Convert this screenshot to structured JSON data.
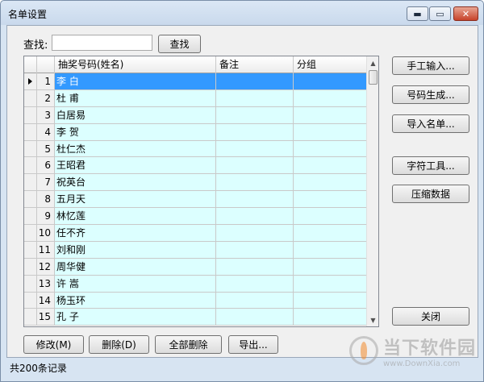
{
  "window": {
    "title": "名单设置"
  },
  "titlebar_buttons": {
    "minimize": "▬",
    "maximize": "▭",
    "close": "✕"
  },
  "search": {
    "label": "查找:",
    "value": "",
    "placeholder": "",
    "button": "查找"
  },
  "table": {
    "columns": [
      "抽奖号码(姓名)",
      "备注",
      "分组"
    ],
    "rows": [
      {
        "num": "1",
        "name": "李  白",
        "note": "",
        "group": "",
        "selected": true
      },
      {
        "num": "2",
        "name": "杜  甫",
        "note": "",
        "group": ""
      },
      {
        "num": "3",
        "name": "白居易",
        "note": "",
        "group": ""
      },
      {
        "num": "4",
        "name": "李  贺",
        "note": "",
        "group": ""
      },
      {
        "num": "5",
        "name": "杜仁杰",
        "note": "",
        "group": ""
      },
      {
        "num": "6",
        "name": "王昭君",
        "note": "",
        "group": ""
      },
      {
        "num": "7",
        "name": "祝英台",
        "note": "",
        "group": ""
      },
      {
        "num": "8",
        "name": "五月天",
        "note": "",
        "group": ""
      },
      {
        "num": "9",
        "name": "林忆莲",
        "note": "",
        "group": ""
      },
      {
        "num": "10",
        "name": "任不齐",
        "note": "",
        "group": ""
      },
      {
        "num": "11",
        "name": "刘和刚",
        "note": "",
        "group": ""
      },
      {
        "num": "12",
        "name": "周华健",
        "note": "",
        "group": ""
      },
      {
        "num": "13",
        "name": "许  嵩",
        "note": "",
        "group": ""
      },
      {
        "num": "14",
        "name": "杨玉环",
        "note": "",
        "group": ""
      },
      {
        "num": "15",
        "name": "孔  子",
        "note": "",
        "group": ""
      }
    ]
  },
  "side_buttons": {
    "manual_input": "手工输入...",
    "generate_numbers": "号码生成...",
    "import_list": "导入名单...",
    "char_tools": "字符工具...",
    "compress_data": "压缩数据",
    "close": "关闭"
  },
  "bottom_buttons": {
    "edit": "修改(M)",
    "delete": "删除(D)",
    "delete_all": "全部删除",
    "export": "导出..."
  },
  "status": {
    "text": "共200条记录"
  },
  "watermark": {
    "cn": "当下软件园",
    "en": "www.DownXia.com"
  },
  "colors": {
    "row_bg": "#dcffff",
    "selected_bg": "#3399ff",
    "window_bg": "#f0f0f0"
  }
}
